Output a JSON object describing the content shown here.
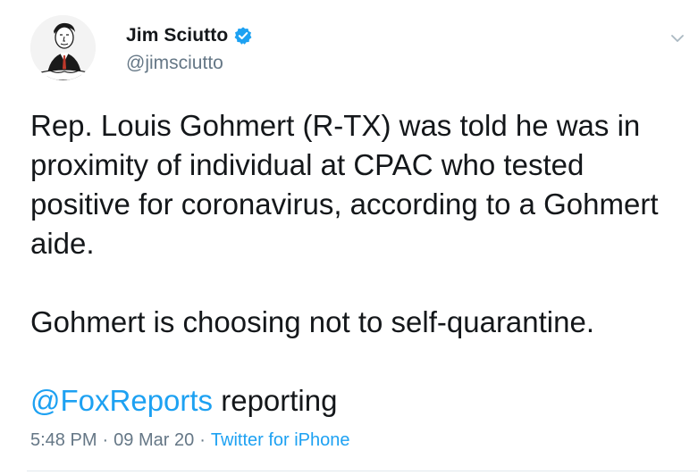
{
  "author": {
    "display_name": "Jim Sciutto",
    "handle": "@jimsciutto",
    "verified": true,
    "avatar_icon": "caricature-avatar"
  },
  "tweet": {
    "paragraph_1": "Rep. Louis Gohmert (R-TX) was told he was in proximity of individual at CPAC who tested positive for coronavirus, according to a Gohmert aide.",
    "paragraph_2": "Gohmert is choosing not to self-quarantine.",
    "mention": "@FoxReports",
    "mention_suffix": " reporting"
  },
  "meta": {
    "time": "5:48 PM",
    "separator": "·",
    "date": "09 Mar 20",
    "source": "Twitter for iPhone"
  },
  "colors": {
    "link": "#1da1f2",
    "secondary_text": "#657786",
    "primary_text": "#14171a",
    "verified_badge": "#1da1f2"
  },
  "icons": {
    "verified": "verified-badge-icon",
    "caret": "chevron-down-icon"
  }
}
